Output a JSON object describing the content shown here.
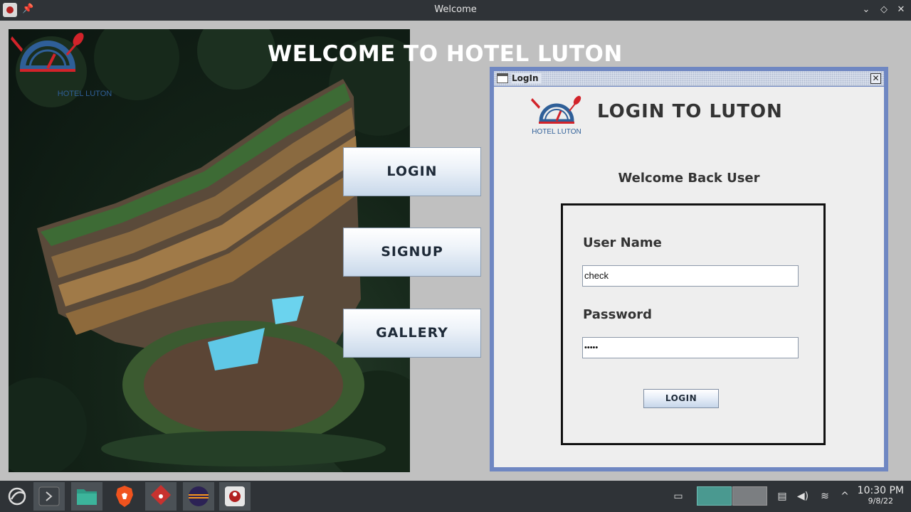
{
  "window": {
    "title": "Welcome",
    "pin_glyph": "📌",
    "minimize_glyph": "⌄",
    "maximize_glyph": "◇",
    "close_glyph": "✕"
  },
  "main": {
    "heading": "WELCOME TO HOTEL LUTON",
    "logo_text": "HOTEL LUTON",
    "buttons": {
      "login": "LOGIN",
      "signup": "SIGNUP",
      "gallery": "GALLERY"
    }
  },
  "login_frame": {
    "title": "LogIn",
    "close_glyph": "✕",
    "logo_text": "HOTEL LUTON",
    "heading": "LOGIN TO LUTON",
    "welcome_text": "Welcome Back User",
    "username_label": "User Name",
    "username_value": "check",
    "password_label": "Password",
    "password_value": "•••••",
    "login_button": "LOGIN"
  },
  "taskbar": {
    "time": "10:30 PM",
    "date": "9/8/22",
    "chevron_glyph": "^"
  },
  "colors": {
    "title_bar": "#2f3337",
    "frame_border": "#6f87c2",
    "desktop_bg": "#c0c0c0",
    "logo_red": "#d2232a",
    "logo_blue": "#2f5f98"
  }
}
